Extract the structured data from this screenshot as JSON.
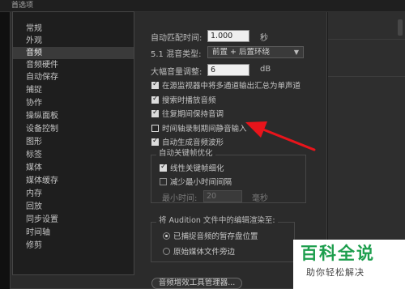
{
  "dialog": {
    "title": "首选项"
  },
  "sidebar": {
    "items": [
      {
        "label": "常规"
      },
      {
        "label": "外观"
      },
      {
        "label": "音频",
        "active": true
      },
      {
        "label": "音频硬件"
      },
      {
        "label": "自动保存"
      },
      {
        "label": "捕捉"
      },
      {
        "label": "协作"
      },
      {
        "label": "操纵面板"
      },
      {
        "label": "设备控制"
      },
      {
        "label": "图形"
      },
      {
        "label": "标签"
      },
      {
        "label": "媒体"
      },
      {
        "label": "媒体缓存"
      },
      {
        "label": "内存"
      },
      {
        "label": "回放"
      },
      {
        "label": "同步设置"
      },
      {
        "label": "时间轴"
      },
      {
        "label": "修剪"
      }
    ]
  },
  "audio": {
    "auto_match": {
      "label": "自动匹配时间:",
      "value": "1.000",
      "unit": "秒"
    },
    "mix_type": {
      "label": "5.1 混音类型:",
      "value": "前置 + 后置环绕"
    },
    "large_volume": {
      "label": "大幅音量调整:",
      "value": "6",
      "unit": "dB"
    },
    "options": [
      {
        "label": "在源监视器中将多通道输出汇总为单声道",
        "checked": true
      },
      {
        "label": "搜索时播放音频",
        "checked": true
      },
      {
        "label": "往复期间保持音调",
        "checked": true
      },
      {
        "label": "时间轴录制期间静音输入",
        "checked": false,
        "highlighted": true
      },
      {
        "label": "自动生成音频波形",
        "checked": true
      }
    ],
    "keyframe_group": {
      "title": "自动关键帧优化",
      "linear": {
        "label": "线性关键帧细化",
        "checked": true
      },
      "min_interval": {
        "label": "减少最小时间间隔",
        "checked": false
      },
      "min_time": {
        "label": "最小时间:",
        "value": "20",
        "unit": "毫秒"
      }
    },
    "render_group": {
      "title": "将 Audition 文件中的编辑渲染至:",
      "options": [
        {
          "label": "已捕捉音频的暂存盘位置",
          "selected": true
        },
        {
          "label": "原始媒体文件旁边",
          "selected": false
        }
      ]
    },
    "plugin_manager_button": "音频增效工具管理器..."
  },
  "annotation": {
    "arrow_color": "#e8141b"
  },
  "watermark": {
    "title": "百科全说",
    "subtitle": "助你轻松解决",
    "color": "#1d9e4d"
  }
}
